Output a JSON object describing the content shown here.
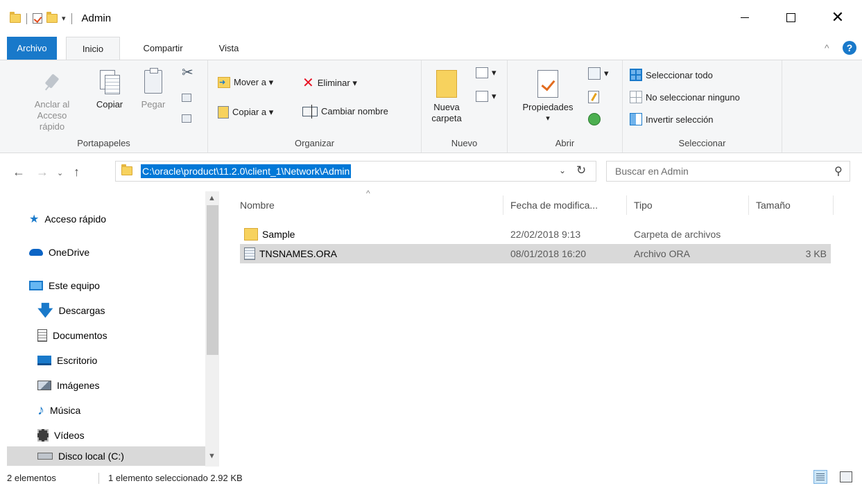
{
  "window": {
    "title": "Admin",
    "controls": {
      "minimize": "",
      "maximize": "",
      "close": "✕"
    },
    "qat_dropdown": "▾"
  },
  "tabs": {
    "archivo": "Archivo",
    "inicio": "Inicio",
    "compartir": "Compartir",
    "vista": "Vista",
    "collapse": "^",
    "help": "?"
  },
  "ribbon": {
    "portapapeles": {
      "label": "Portapapeles",
      "pin": "Anclar al Acceso rápido",
      "copy": "Copiar",
      "paste": "Pegar"
    },
    "organizar": {
      "label": "Organizar",
      "move_to": "Mover a ▾",
      "copy_to": "Copiar a ▾",
      "delete": "Eliminar ▾",
      "rename": "Cambiar nombre"
    },
    "nuevo": {
      "label": "Nuevo",
      "new_folder": "Nueva carpeta"
    },
    "abrir": {
      "label": "Abrir",
      "properties": "Propiedades",
      "properties_arrow": "▾"
    },
    "seleccionar": {
      "label": "Seleccionar",
      "select_all": "Seleccionar todo",
      "select_none": "No seleccionar ninguno",
      "invert": "Invertir selección"
    }
  },
  "address": {
    "path": "C:\\oracle\\product\\11.2.0\\client_1\\Network\\Admin",
    "dropdown": "⌄",
    "refresh": "↻",
    "search_placeholder": "Buscar en Admin"
  },
  "nav": {
    "back": "←",
    "forward": "→",
    "recent": "⌄",
    "up": "↑",
    "items": [
      {
        "label": "Acceso rápido"
      },
      {
        "label": "OneDrive"
      },
      {
        "label": "Este equipo"
      },
      {
        "label": "Descargas"
      },
      {
        "label": "Documentos"
      },
      {
        "label": "Escritorio"
      },
      {
        "label": "Imágenes"
      },
      {
        "label": "Música"
      },
      {
        "label": "Vídeos"
      },
      {
        "label": "Disco local (C:)"
      }
    ]
  },
  "files": {
    "columns": {
      "name": "Nombre",
      "date": "Fecha de modifica...",
      "type": "Tipo",
      "size": "Tamaño"
    },
    "rows": [
      {
        "name": "Sample",
        "date": "22/02/2018 9:13",
        "type": "Carpeta de archivos",
        "size": ""
      },
      {
        "name": "TNSNAMES.ORA",
        "date": "08/01/2018 16:20",
        "type": "Archivo ORA",
        "size": "3 KB"
      }
    ]
  },
  "status": {
    "count": "2 elementos",
    "selection": "1 elemento seleccionado  2.92 KB"
  },
  "colors": {
    "accent": "#1979ca",
    "selection": "#0078d7",
    "row_selected": "#d9d9d9"
  }
}
